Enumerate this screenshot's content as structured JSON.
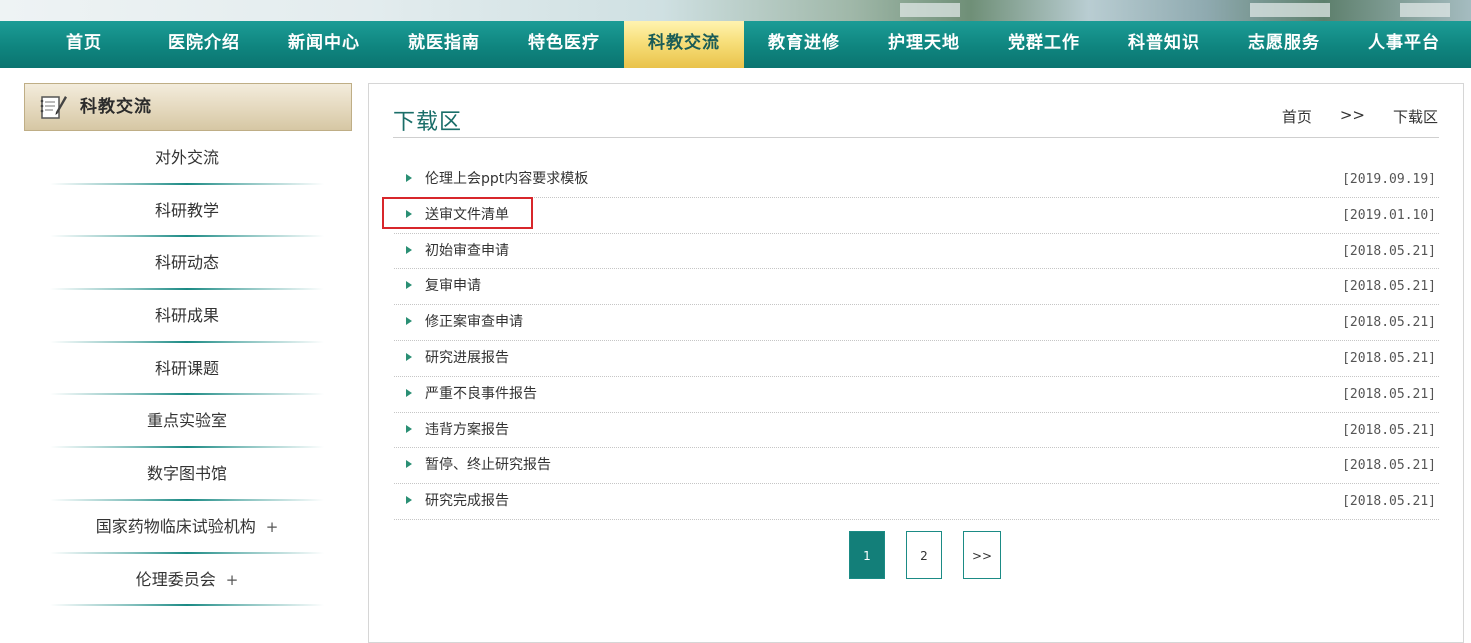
{
  "nav": {
    "items": [
      "首页",
      "医院介绍",
      "新闻中心",
      "就医指南",
      "特色医疗",
      "科教交流",
      "教育进修",
      "护理天地",
      "党群工作",
      "科普知识",
      "志愿服务",
      "人事平台"
    ],
    "active_index": 5
  },
  "sidebar": {
    "title": "科教交流",
    "items": [
      {
        "label": "对外交流"
      },
      {
        "label": "科研教学"
      },
      {
        "label": "科研动态"
      },
      {
        "label": "科研成果"
      },
      {
        "label": "科研课题"
      },
      {
        "label": "重点实验室"
      },
      {
        "label": "数字图书馆"
      },
      {
        "label": "国家药物临床试验机构",
        "expand": "+"
      },
      {
        "label": "伦理委员会",
        "expand": "+"
      }
    ]
  },
  "main": {
    "title": "下载区",
    "breadcrumb": {
      "home": "首页",
      "separator": ">>",
      "current": "下载区"
    },
    "files": [
      {
        "name": "伦理上会ppt内容要求模板",
        "date": "[2019.09.19]"
      },
      {
        "name": "送审文件清单",
        "date": "[2019.01.10]"
      },
      {
        "name": "初始审查申请",
        "date": "[2018.05.21]"
      },
      {
        "name": "复审申请",
        "date": "[2018.05.21]"
      },
      {
        "name": "修正案审查申请",
        "date": "[2018.05.21]"
      },
      {
        "name": "研究进展报告",
        "date": "[2018.05.21]"
      },
      {
        "name": "严重不良事件报告",
        "date": "[2018.05.21]"
      },
      {
        "name": "违背方案报告",
        "date": "[2018.05.21]"
      },
      {
        "name": "暂停、终止研究报告",
        "date": "[2018.05.21]"
      },
      {
        "name": "研究完成报告",
        "date": "[2018.05.21]"
      }
    ],
    "highlighted_index": 1
  },
  "pagination": {
    "pages": [
      "1",
      "2"
    ],
    "current": "1",
    "next": ">>"
  },
  "colors": {
    "nav_bg": "#0f857f",
    "nav_active": "#f7df7a",
    "title": "#1a6e69",
    "highlight": "#d8262b",
    "page_active": "#137f79"
  }
}
